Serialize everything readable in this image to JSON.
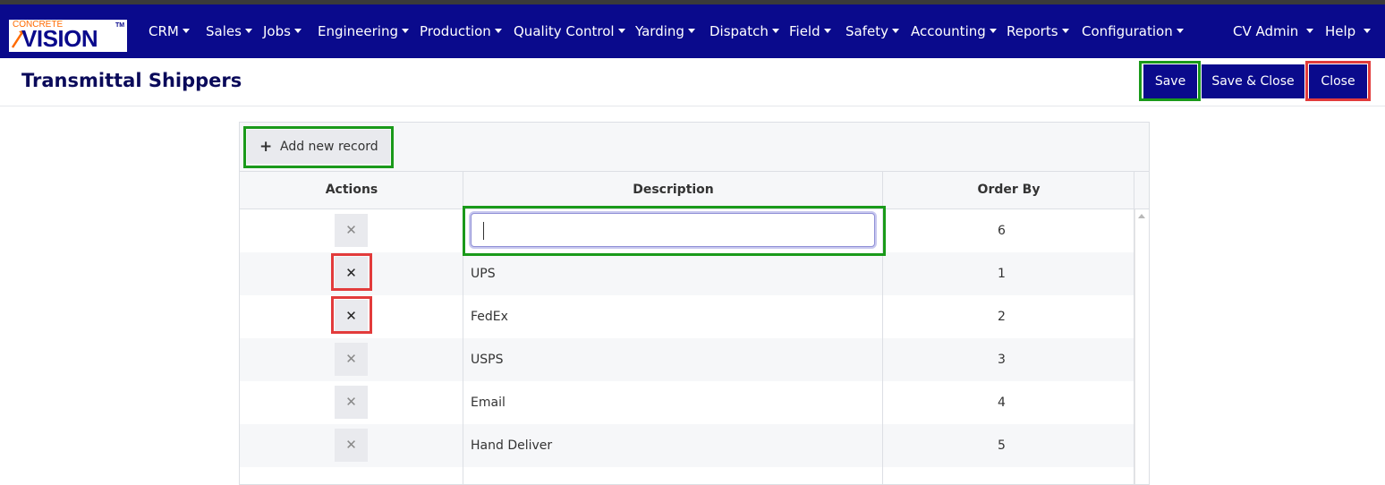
{
  "app": {
    "logo_top": "CONCRETE",
    "logo_main": "VISION",
    "logo_tm": "TM"
  },
  "nav": {
    "items": [
      "CRM",
      "Sales",
      "Jobs",
      "Engineering",
      "Production",
      "Quality Control",
      "Yarding",
      "Dispatch",
      "Field",
      "Safety",
      "Accounting",
      "Reports",
      "Configuration"
    ],
    "user": "CV Admin",
    "help": "Help"
  },
  "page": {
    "title": "Transmittal Shippers"
  },
  "toolbar": {
    "save_label": "Save",
    "save_close_label": "Save & Close",
    "close_label": "Close",
    "add_label": "Add new record",
    "add_icon": "plus-icon"
  },
  "grid": {
    "columns": [
      "Actions",
      "Description",
      "Order By"
    ],
    "edit_row": {
      "description": "",
      "order_by": "6"
    },
    "rows": [
      {
        "description": "UPS",
        "order_by": "1"
      },
      {
        "description": "FedEx",
        "order_by": "2"
      },
      {
        "description": "USPS",
        "order_by": "3"
      },
      {
        "description": "Email",
        "order_by": "4"
      },
      {
        "description": "Hand Deliver",
        "order_by": "5"
      }
    ],
    "delete_symbol": "✕"
  },
  "colors": {
    "navbar": "#0a0a8c",
    "highlight_green": "#1a9a1a",
    "highlight_red": "#e23b3b"
  }
}
